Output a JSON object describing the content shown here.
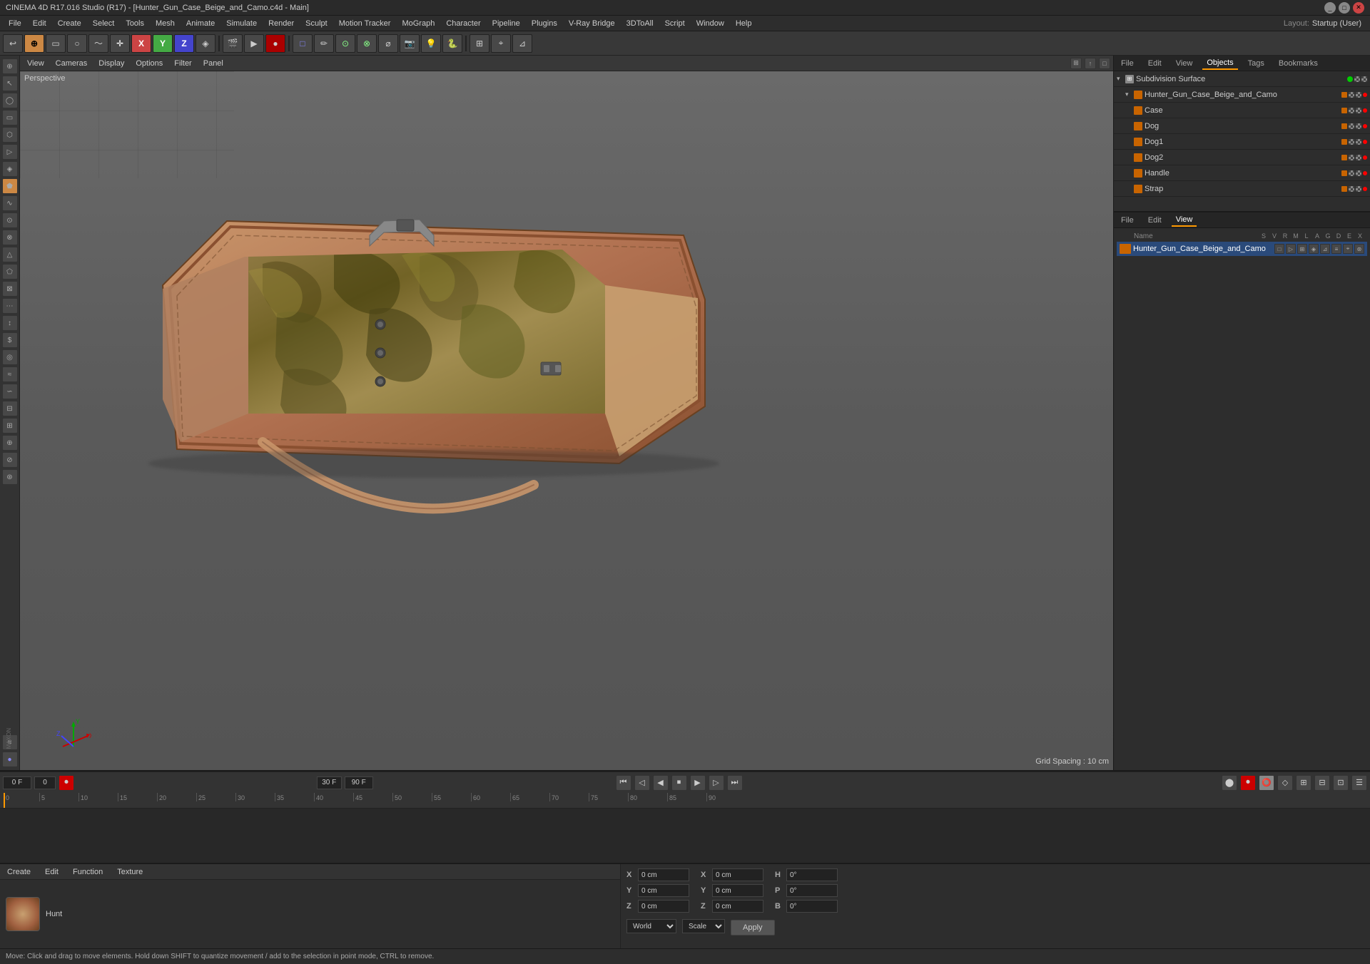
{
  "window": {
    "title": "CINEMA 4D R17.016 Studio (R17) - [Hunter_Gun_Case_Beige_and_Camo.c4d - Main]",
    "layout_label": "Layout:",
    "layout_value": "Startup (User)"
  },
  "menubar": {
    "items": [
      "File",
      "Edit",
      "Create",
      "Select",
      "Tools",
      "Mesh",
      "Animate",
      "Simulate",
      "Render",
      "Sculpt",
      "Motion Tracker",
      "MoGraph",
      "Character",
      "Pipeline",
      "Plugins",
      "V-Ray Bridge",
      "3DToAll",
      "Script",
      "Window",
      "Help"
    ]
  },
  "viewport": {
    "label": "Perspective",
    "grid_spacing": "Grid Spacing : 10 cm",
    "menus": [
      "View",
      "Cameras",
      "Display",
      "Options",
      "Filter",
      "Panel"
    ]
  },
  "objects_panel": {
    "header_tabs": [
      "File",
      "Edit",
      "View",
      "Objects",
      "Tags",
      "Bookmarks"
    ],
    "items": [
      {
        "name": "Subdivision Surface",
        "indent": 0,
        "icon": "subdivision",
        "has_toggle": true
      },
      {
        "name": "Hunter_Gun_Case_Beige_and_Camo",
        "indent": 1,
        "icon": "group"
      },
      {
        "name": "Case",
        "indent": 2,
        "icon": "mesh"
      },
      {
        "name": "Dog",
        "indent": 2,
        "icon": "mesh"
      },
      {
        "name": "Dog1",
        "indent": 2,
        "icon": "mesh"
      },
      {
        "name": "Dog2",
        "indent": 2,
        "icon": "mesh"
      },
      {
        "name": "Handle",
        "indent": 2,
        "icon": "mesh"
      },
      {
        "name": "Strap",
        "indent": 2,
        "icon": "mesh"
      }
    ]
  },
  "properties_panel": {
    "header_tabs": [
      "File",
      "Edit",
      "View"
    ],
    "column_headers": [
      "S",
      "V",
      "R",
      "M",
      "L",
      "A",
      "G",
      "D",
      "E",
      "X"
    ],
    "selected_item": "Hunter_Gun_Case_Beige_and_Camo"
  },
  "timeline": {
    "ruler_marks": [
      "0",
      "5",
      "10",
      "15",
      "20",
      "25",
      "30",
      "35",
      "40",
      "45",
      "50",
      "55",
      "60",
      "65",
      "70",
      "75",
      "80",
      "85",
      "90"
    ],
    "frame_current": "0 F",
    "frame_start": "0 F",
    "frame_fps": "30 F",
    "frame_end": "90 F"
  },
  "material": {
    "menus": [
      "Create",
      "Edit",
      "Function",
      "Texture"
    ],
    "name": "Hunt"
  },
  "coordinates": {
    "x_label": "X",
    "x_val": "0 cm",
    "y_label": "Y",
    "y_val": "0 cm",
    "z_label": "Z",
    "z_val": "0 cm",
    "h_label": "H",
    "h_val": "0°",
    "p_label": "P",
    "p_val": "0°",
    "b_label": "B",
    "b_val": "0°",
    "x2_val": "0 cm",
    "y2_val": "0 cm",
    "z2_val": "0 cm",
    "coord_mode": "World",
    "scale_mode": "Scale",
    "apply_label": "Apply"
  },
  "statusbar": {
    "text": "Move: Click and drag to move elements. Hold down SHIFT to quantize movement / add to the selection in point mode, CTRL to remove."
  }
}
